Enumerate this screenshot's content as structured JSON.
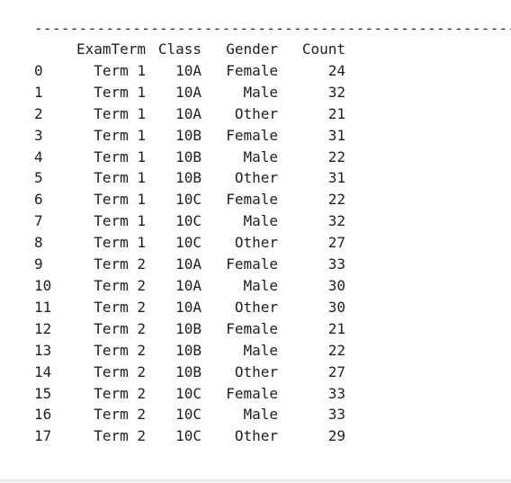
{
  "separator": "--------------------------------------------------------------------",
  "columns": {
    "examterm": "ExamTerm",
    "class": "Class",
    "gender": "Gender",
    "count": "Count"
  },
  "rows": [
    {
      "index": "0",
      "examterm": "Term 1",
      "class": "10A",
      "gender": "Female",
      "count": "24"
    },
    {
      "index": "1",
      "examterm": "Term 1",
      "class": "10A",
      "gender": "Male",
      "count": "32"
    },
    {
      "index": "2",
      "examterm": "Term 1",
      "class": "10A",
      "gender": "Other",
      "count": "21"
    },
    {
      "index": "3",
      "examterm": "Term 1",
      "class": "10B",
      "gender": "Female",
      "count": "31"
    },
    {
      "index": "4",
      "examterm": "Term 1",
      "class": "10B",
      "gender": "Male",
      "count": "22"
    },
    {
      "index": "5",
      "examterm": "Term 1",
      "class": "10B",
      "gender": "Other",
      "count": "31"
    },
    {
      "index": "6",
      "examterm": "Term 1",
      "class": "10C",
      "gender": "Female",
      "count": "22"
    },
    {
      "index": "7",
      "examterm": "Term 1",
      "class": "10C",
      "gender": "Male",
      "count": "32"
    },
    {
      "index": "8",
      "examterm": "Term 1",
      "class": "10C",
      "gender": "Other",
      "count": "27"
    },
    {
      "index": "9",
      "examterm": "Term 2",
      "class": "10A",
      "gender": "Female",
      "count": "33"
    },
    {
      "index": "10",
      "examterm": "Term 2",
      "class": "10A",
      "gender": "Male",
      "count": "30"
    },
    {
      "index": "11",
      "examterm": "Term 2",
      "class": "10A",
      "gender": "Other",
      "count": "30"
    },
    {
      "index": "12",
      "examterm": "Term 2",
      "class": "10B",
      "gender": "Female",
      "count": "21"
    },
    {
      "index": "13",
      "examterm": "Term 2",
      "class": "10B",
      "gender": "Male",
      "count": "22"
    },
    {
      "index": "14",
      "examterm": "Term 2",
      "class": "10B",
      "gender": "Other",
      "count": "27"
    },
    {
      "index": "15",
      "examterm": "Term 2",
      "class": "10C",
      "gender": "Female",
      "count": "33"
    },
    {
      "index": "16",
      "examterm": "Term 2",
      "class": "10C",
      "gender": "Male",
      "count": "33"
    },
    {
      "index": "17",
      "examterm": "Term 2",
      "class": "10C",
      "gender": "Other",
      "count": "29"
    }
  ]
}
